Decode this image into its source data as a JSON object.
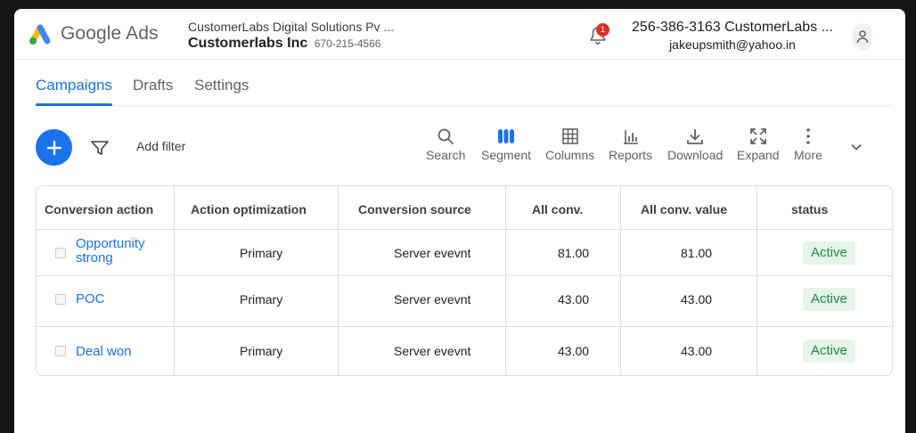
{
  "header": {
    "logo_text": "Google Ads",
    "account_line1": "CustomerLabs Digital Solutions Pv ...",
    "account_name": "Customerlabs Inc",
    "account_id": "670-215-4566",
    "notification_count": "1",
    "user_phone": "256-386-3163 CustomerLabs ...",
    "user_email": "jakeupsmith@yahoo.in"
  },
  "tabs": [
    {
      "label": "Campaigns",
      "active": true
    },
    {
      "label": "Drafts",
      "active": false
    },
    {
      "label": "Settings",
      "active": false
    }
  ],
  "toolbar": {
    "add_filter": "Add filter",
    "tools": [
      {
        "label": "Search",
        "icon": "search-icon"
      },
      {
        "label": "Segment",
        "icon": "segment-icon"
      },
      {
        "label": "Columns",
        "icon": "columns-icon"
      },
      {
        "label": "Reports",
        "icon": "reports-icon"
      },
      {
        "label": "Download",
        "icon": "download-icon"
      },
      {
        "label": "Expand",
        "icon": "expand-icon"
      },
      {
        "label": "More",
        "icon": "more-icon"
      }
    ]
  },
  "table": {
    "columns": [
      "Conversion action",
      "Action optimization",
      "Conversion source",
      "All conv.",
      "All conv. value",
      "status"
    ],
    "rows": [
      {
        "name_line1": "Opportunity",
        "name_line2": "strong",
        "optimization": "Primary",
        "source": "Server evevnt",
        "all_conv": "81.00",
        "all_conv_value": "81.00",
        "status": "Active"
      },
      {
        "name_line1": "POC",
        "name_line2": "",
        "optimization": "Primary",
        "source": "Server evevnt",
        "all_conv": "43.00",
        "all_conv_value": "43.00",
        "status": "Active"
      },
      {
        "name_line1": "Deal won",
        "name_line2": "",
        "optimization": "Primary",
        "source": "Server evevnt",
        "all_conv": "43.00",
        "all_conv_value": "43.00",
        "status": "Active"
      }
    ]
  },
  "colors": {
    "accent": "#1a73e8",
    "status_bg": "#e6f4ea",
    "status_text": "#1e8e3e",
    "badge": "#d93025"
  }
}
